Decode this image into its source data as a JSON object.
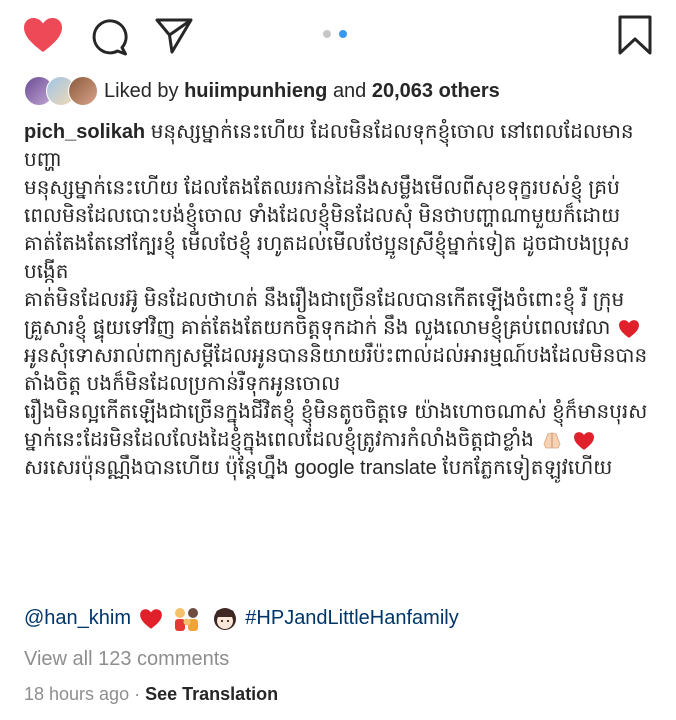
{
  "colors": {
    "heart": "#ed4956",
    "link": "#003569",
    "muted": "#8e8e8e",
    "dot_active": "#3897f0",
    "dot_inactive": "#c7c7c7"
  },
  "actions": {
    "icons": [
      "heart-filled-icon",
      "comment-icon",
      "share-icon",
      "bookmark-icon"
    ],
    "carousel": {
      "count": 2,
      "active": 2
    }
  },
  "likes": {
    "prefix": "Liked by",
    "user": "huiimpunhieng",
    "and": "and",
    "others": "20,063 others"
  },
  "caption": {
    "username": "pich_solikah",
    "headline": "មនុស្សម្នាក់នេះហើយ ដែលមិនដែលទុកខ្ញុំចោល នៅពេលដែលមានបញ្ហា",
    "paragraph1": "មនុស្សម្នាក់នេះហើយ ដែលតែងតែឈរកាន់ដៃនឹងសម្លឹងមើលពីសុខទុក្ខរបស់ខ្ញុំ គ្រប់ពេលមិនដែលបោះបង់ខ្ញុំចោល ទាំងដែលខ្ញុំមិនដែលសុំ មិនថាបញ្ហាណាមួយក៏ដោយ គាត់តែងតែនៅក្បែរខ្ញុំ មើលថែខ្ញុំ រហូតដល់មើលថែប្អូនស្រីខ្ញុំម្នាក់ទៀត ដូចជាបងប្រុសបង្កើត",
    "paragraph2a": "គាត់មិនដែលរអ៊ូ មិនដែលថាហត់ នឹងរឿងជាច្រើនដែលបានកើតឡើងចំពោះខ្ញុំ រឺ ក្រុមគ្រួសារខ្ញុំ ផ្ទុយទៅវិញ គាត់តែងតែយកចិត្តទុកដាក់ នឹង លួងលោមខ្ញុំគ្រប់ពេលវេលា",
    "paragraph2b": "អូនសុំទោសរាល់ពាក្យសម្ដីដែលអូនបាននិយាយរឹប៉ះពាល់ដល់អារម្មណ៍បងដែលមិនបានតាំងចិត្ត បងក៏មិនដែលប្រកាន់រឺទុកអូនចោល",
    "paragraph3a": "រឿងមិនល្អកើតឡើងជាច្រើនក្នុងជីវិតខ្ញុំ ខ្ញុំមិនតូចចិត្តទេ យ៉ាងហោចណាស់ ខ្ញុំក៏មានបុរសម្នាក់នេះដែរមិនដែលលែងដៃខ្ញុំក្នុងពេលដែលខ្ញុំត្រូវការកំលាំងចិត្តជាខ្លាំង",
    "paragraph3b": "សរសេរប៉ុនណ្ណឹងបានហើយ ប៉ុន្តែហ្នឹង google translate បែកភ្លែកទៀតឡូវហើយ"
  },
  "tags": {
    "mention": "@han_khim",
    "hashtag": "#HPJandLittleHanfamily"
  },
  "comments": {
    "view_all": "View all 123 comments"
  },
  "footer": {
    "time": "18 hours ago",
    "separator": "·",
    "see_translation": "See Translation"
  }
}
